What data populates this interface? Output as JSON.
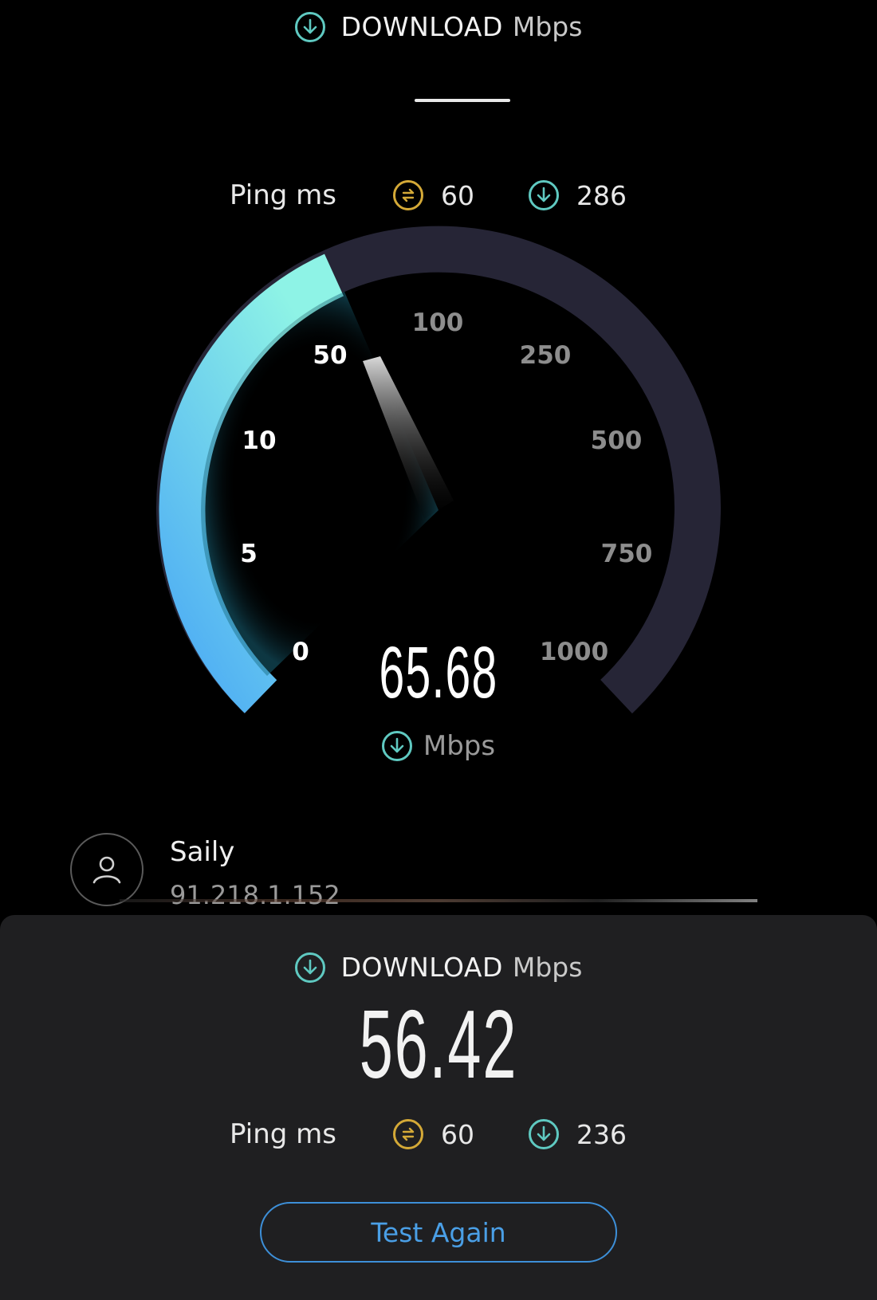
{
  "header": {
    "icon": "download-arrow-icon",
    "title": "DOWNLOAD",
    "unit": "Mbps"
  },
  "live_ping": {
    "label": "Ping ms",
    "idle_icon": "ping-idle-icon",
    "idle_value": "60",
    "download_icon": "download-arrow-icon",
    "download_value": "286"
  },
  "gauge": {
    "ticks": [
      "0",
      "5",
      "10",
      "50",
      "100",
      "250",
      "500",
      "750",
      "1000"
    ],
    "current_value": "65.68",
    "unit": "Mbps",
    "colors": {
      "fill_start": "#4aa9f5",
      "fill_end": "#8ef3e6",
      "track": "#262536"
    }
  },
  "server": {
    "avatar_icon": "user-icon",
    "name": "Saily",
    "ip": "91.218.1.152"
  },
  "result": {
    "title": "DOWNLOAD",
    "unit": "Mbps",
    "value": "56.42",
    "ping_label": "Ping ms",
    "idle_value": "60",
    "download_value": "236",
    "test_again_label": "Test Again"
  },
  "colors": {
    "accent_teal": "#5fc9c1",
    "accent_gold": "#d4a937",
    "button_blue": "#3d8fd8",
    "sheet_bg": "#1f1f21"
  }
}
